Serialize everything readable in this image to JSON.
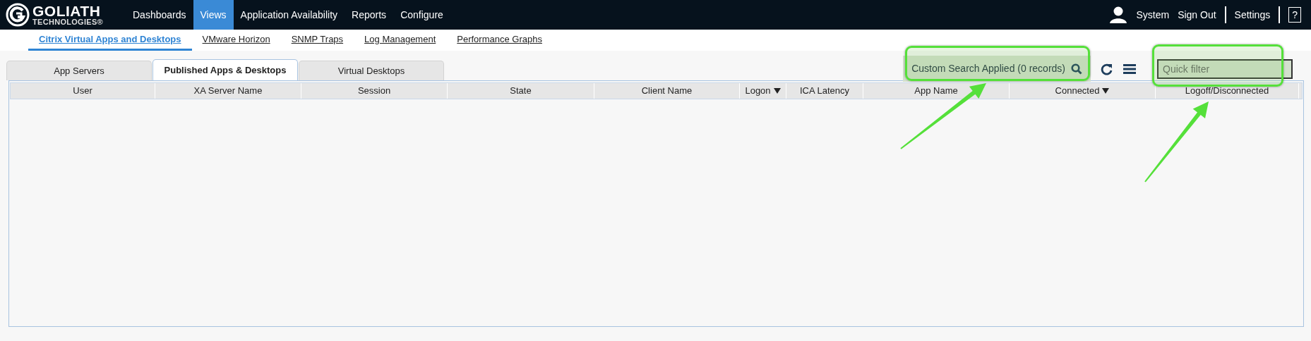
{
  "logo": {
    "name": "GOLIATH",
    "tagline": "TECHNOLOGIES®"
  },
  "nav": [
    {
      "label": "Dashboards",
      "selected": false
    },
    {
      "label": "Views",
      "selected": true
    },
    {
      "label": "Application Availability",
      "selected": false
    },
    {
      "label": "Reports",
      "selected": false
    },
    {
      "label": "Configure",
      "selected": false
    }
  ],
  "user_menu": {
    "user": "System",
    "sign_out": "Sign Out",
    "settings": "Settings",
    "help": "?"
  },
  "subnav": [
    {
      "label": "Citrix Virtual Apps and Desktops",
      "selected": true
    },
    {
      "label": "VMware Horizon",
      "selected": false
    },
    {
      "label": "SNMP Traps",
      "selected": false
    },
    {
      "label": "Log Management",
      "selected": false
    },
    {
      "label": "Performance Graphs",
      "selected": false
    }
  ],
  "tabs": [
    {
      "label": "App Servers",
      "selected": false
    },
    {
      "label": "Published Apps & Desktops",
      "selected": true
    },
    {
      "label": "Virtual Desktops",
      "selected": false
    }
  ],
  "toolbar": {
    "search_status": "Custom Search Applied (0 records)",
    "quick_filter": {
      "placeholder": "Quick filter"
    }
  },
  "table": {
    "columns": [
      {
        "label": "User",
        "sorted": false
      },
      {
        "label": "XA Server Name",
        "sorted": false
      },
      {
        "label": "Session",
        "sorted": false
      },
      {
        "label": "State",
        "sorted": false
      },
      {
        "label": "Client Name",
        "sorted": false
      },
      {
        "label": "Logon",
        "sorted": true
      },
      {
        "label": "ICA Latency",
        "sorted": false
      },
      {
        "label": "App Name",
        "sorted": false
      },
      {
        "label": "Connected",
        "sorted": true
      },
      {
        "label": "Logoff/Disconnected",
        "sorted": false
      }
    ]
  },
  "annotations": [
    {
      "kind": "callout"
    },
    {
      "kind": "callout"
    }
  ]
}
